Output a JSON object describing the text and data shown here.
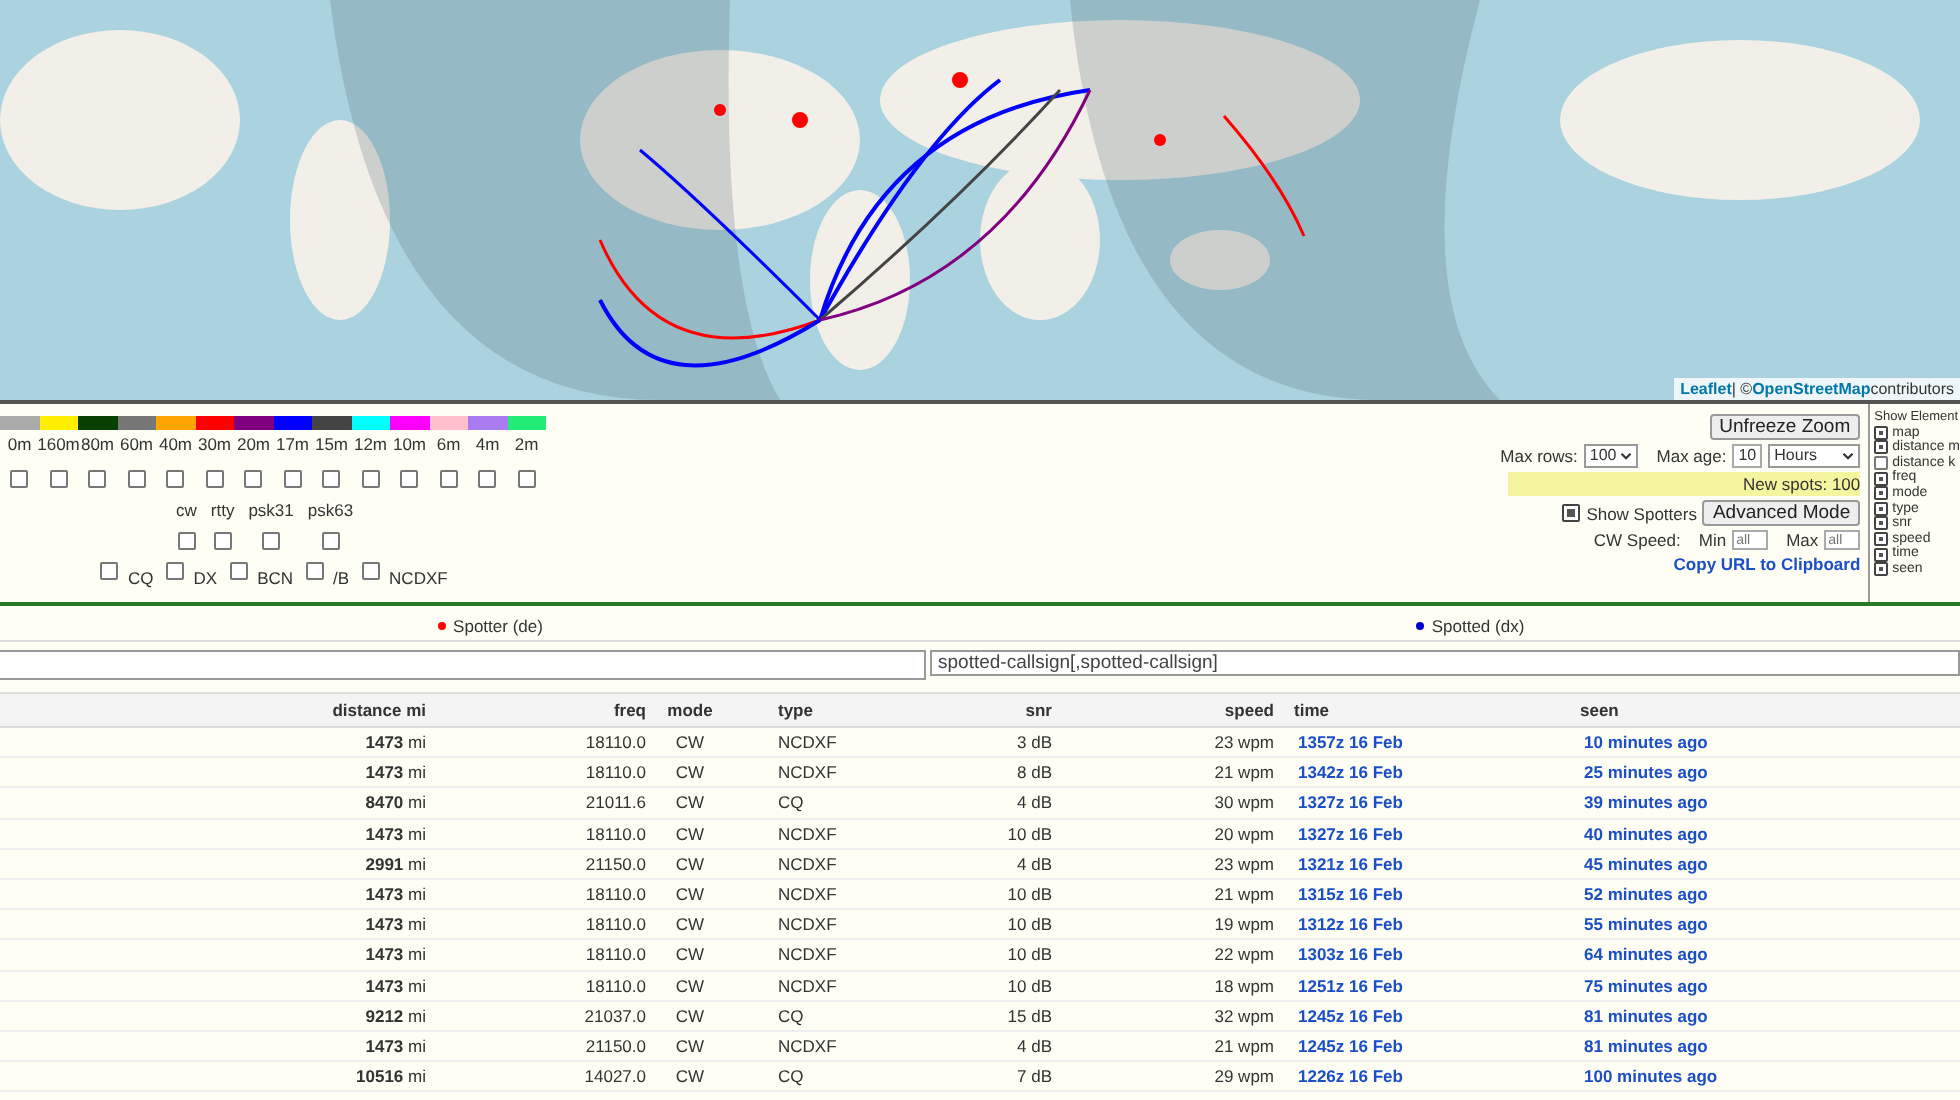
{
  "map": {
    "attribution": {
      "leaflet": "Leaflet",
      "separator": "| ©",
      "osm": "OpenStreetMap",
      "rest": "contributors"
    }
  },
  "bands": [
    {
      "label": "0m",
      "color": "#aaaaaa",
      "checked": false
    },
    {
      "label": "160m",
      "color": "#ffee00",
      "checked": false
    },
    {
      "label": "80m",
      "color": "#093f00",
      "checked": false
    },
    {
      "label": "60m",
      "color": "#777777",
      "checked": false
    },
    {
      "label": "40m",
      "color": "#ffa500",
      "checked": false
    },
    {
      "label": "30m",
      "color": "#ff0000",
      "checked": false
    },
    {
      "label": "20m",
      "color": "#800080",
      "checked": false
    },
    {
      "label": "17m",
      "color": "#0000ff",
      "checked": false
    },
    {
      "label": "15m",
      "color": "#444444",
      "checked": false
    },
    {
      "label": "12m",
      "color": "#00ffff",
      "checked": false
    },
    {
      "label": "10m",
      "color": "#ff00ff",
      "checked": false
    },
    {
      "label": "6m",
      "color": "#ffc0cb",
      "checked": false
    },
    {
      "label": "4m",
      "color": "#a87bf0",
      "checked": false
    },
    {
      "label": "2m",
      "color": "#22ee77",
      "checked": false
    }
  ],
  "modes": [
    {
      "label": "cw",
      "checked": false
    },
    {
      "label": "rtty",
      "checked": false
    },
    {
      "label": "psk31",
      "checked": false
    },
    {
      "label": "psk63",
      "checked": false
    }
  ],
  "types": [
    {
      "label": "CQ",
      "checked": false
    },
    {
      "label": "DX",
      "checked": false
    },
    {
      "label": "BCN",
      "checked": false
    },
    {
      "label": "/B",
      "checked": false
    },
    {
      "label": "NCDXF",
      "checked": false
    }
  ],
  "controls": {
    "unfreeze": "Unfreeze Zoom",
    "max_rows_label": "Max rows:",
    "max_rows": "100",
    "max_age_label": "Max age:",
    "max_age": "10",
    "age_unit": "Hours",
    "new_spots": "New spots: 100",
    "show_spotters": {
      "label": "Show Spotters",
      "checked": true
    },
    "advanced": "Advanced Mode",
    "cw_speed_label": "CW Speed:",
    "min_label": "Min",
    "min_placeholder": "all",
    "max_label": "Max",
    "max_placeholder": "all",
    "copy_url": "Copy URL to Clipboard"
  },
  "show_elements": {
    "title": "Show Element",
    "items": [
      {
        "label": "map",
        "checked": true
      },
      {
        "label": "distance m",
        "checked": true
      },
      {
        "label": "distance k",
        "checked": false
      },
      {
        "label": "freq",
        "checked": true
      },
      {
        "label": "mode",
        "checked": true
      },
      {
        "label": "type",
        "checked": true
      },
      {
        "label": "snr",
        "checked": true
      },
      {
        "label": "speed",
        "checked": true
      },
      {
        "label": "time",
        "checked": true
      },
      {
        "label": "seen",
        "checked": true
      }
    ]
  },
  "legend": {
    "spotter": {
      "label": "Spotter (de)",
      "color": "#ff0000"
    },
    "spotted": {
      "label": "Spotted (dx)",
      "color": "#0000cc"
    }
  },
  "filters": {
    "spotted_placeholder": "spotted-callsign[,spotted-callsign]"
  },
  "table": {
    "columns": [
      "distance mi",
      "freq",
      "mode",
      "type",
      "snr",
      "speed",
      "time",
      "seen"
    ],
    "rows": [
      [
        "**1473** mi",
        "18110.0",
        "CW",
        "NCDXF",
        "3 dB",
        "23 wpm",
        "1357z 16 Feb",
        "10 minutes ago"
      ],
      [
        "**1473** mi",
        "18110.0",
        "CW",
        "NCDXF",
        "8 dB",
        "21 wpm",
        "1342z 16 Feb",
        "25 minutes ago"
      ],
      [
        "**8470** mi",
        "21011.6",
        "CW",
        "CQ",
        "4 dB",
        "30 wpm",
        "1327z 16 Feb",
        "39 minutes ago"
      ],
      [
        "**1473** mi",
        "18110.0",
        "CW",
        "NCDXF",
        "10 dB",
        "20 wpm",
        "1327z 16 Feb",
        "40 minutes ago"
      ],
      [
        "**2991** mi",
        "21150.0",
        "CW",
        "NCDXF",
        "4 dB",
        "23 wpm",
        "1321z 16 Feb",
        "45 minutes ago"
      ],
      [
        "**1473** mi",
        "18110.0",
        "CW",
        "NCDXF",
        "10 dB",
        "21 wpm",
        "1315z 16 Feb",
        "52 minutes ago"
      ],
      [
        "**1473** mi",
        "18110.0",
        "CW",
        "NCDXF",
        "10 dB",
        "19 wpm",
        "1312z 16 Feb",
        "55 minutes ago"
      ],
      [
        "**1473** mi",
        "18110.0",
        "CW",
        "NCDXF",
        "10 dB",
        "22 wpm",
        "1303z 16 Feb",
        "64 minutes ago"
      ],
      [
        "**1473** mi",
        "18110.0",
        "CW",
        "NCDXF",
        "10 dB",
        "18 wpm",
        "1251z 16 Feb",
        "75 minutes ago"
      ],
      [
        "**9212** mi",
        "21037.0",
        "CW",
        "CQ",
        "15 dB",
        "32 wpm",
        "1245z 16 Feb",
        "81 minutes ago"
      ],
      [
        "**1473** mi",
        "21150.0",
        "CW",
        "NCDXF",
        "4 dB",
        "21 wpm",
        "1245z 16 Feb",
        "81 minutes ago"
      ],
      [
        "**10516** mi",
        "14027.0",
        "CW",
        "CQ",
        "7 dB",
        "29 wpm",
        "1226z 16 Feb",
        "100 minutes ago"
      ]
    ]
  }
}
